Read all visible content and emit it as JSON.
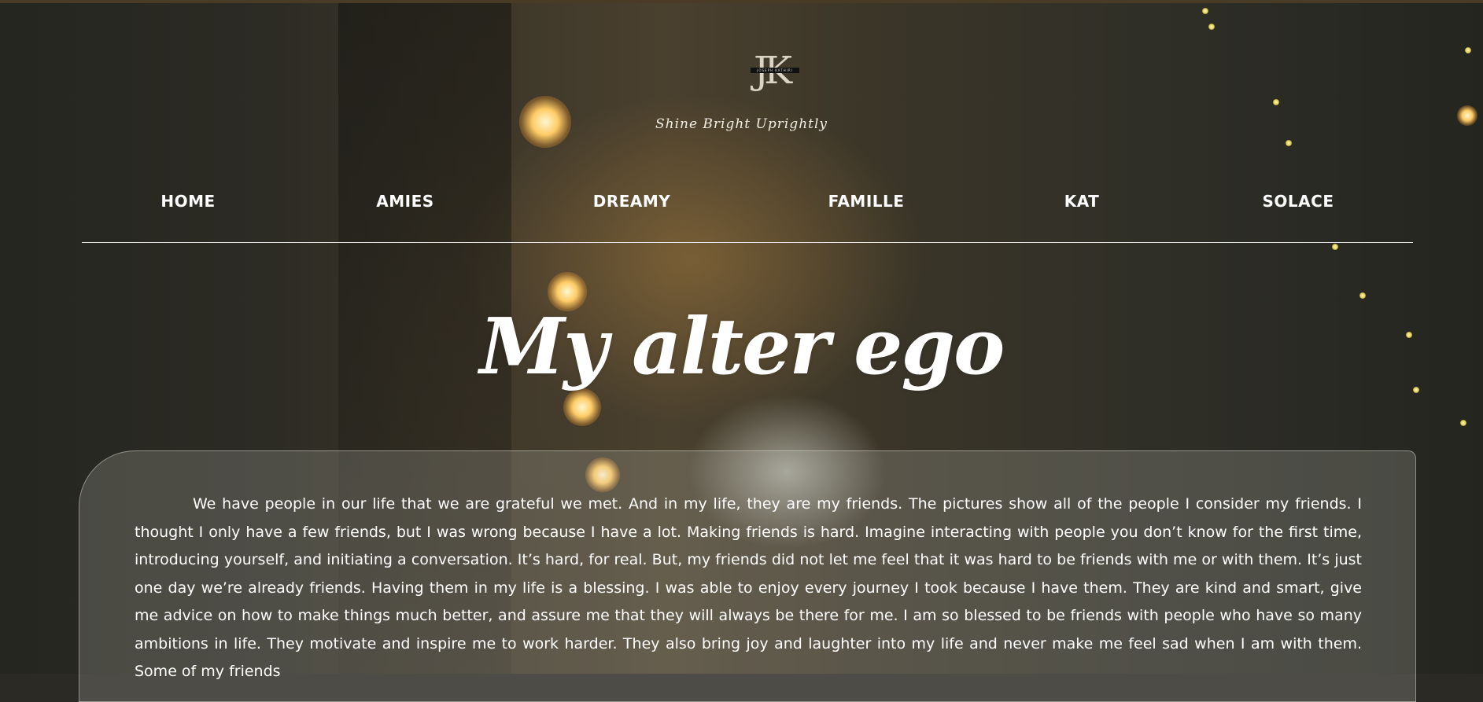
{
  "site": {
    "logo_text": "JK",
    "logo_strip_text": "JOSEPH KATHIRI",
    "tagline": "Shine Bright Uprightly"
  },
  "nav": {
    "items": [
      {
        "label": "HOME"
      },
      {
        "label": "AMIES"
      },
      {
        "label": "DREAMY"
      },
      {
        "label": "FAMILLE"
      },
      {
        "label": "KAT"
      },
      {
        "label": "SOLACE"
      }
    ]
  },
  "main": {
    "title": "My alter ego",
    "body": "We have people in our life that we are grateful we met. And in my life, they are my friends. The pictures show all of the people I consider my friends. I thought I only have a few friends, but I was wrong because I have a lot. Making friends is hard. Imagine interacting with people you don’t know for the first time, introducing yourself, and initiating a conversation. It’s hard, for real. But, my friends did not let me feel that it was hard to be friends with me or with them. It’s just one day we’re already friends. Having them in my life is a blessing. I was able to enjoy every journey I took because I have them. They are kind and smart, give me advice on how to make things much better, and assure me that they will always be there for me. I am so blessed to be friends with people who have so many ambitions in life. They motivate and inspire me to work harder. They also bring joy and laughter into my life and never make me feel sad when I am with them. Some of my friends"
  },
  "colors": {
    "text": "#ffffff",
    "background": "#2b2a24",
    "nav_divider": "#e6e6e6",
    "card_border": "#e6e6dc"
  }
}
